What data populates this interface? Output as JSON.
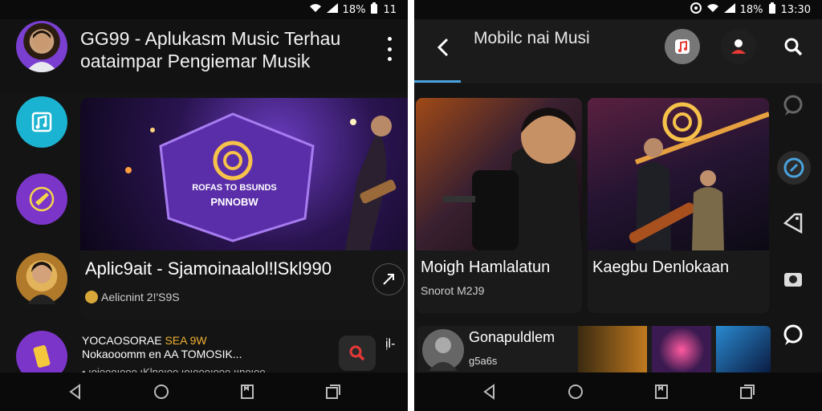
{
  "left": {
    "status": {
      "battery_text": "18%",
      "time": "11"
    },
    "header": {
      "title": "GG99 - Aplukasm Music Terhau oataimpar Pengiemar Musik"
    },
    "feature": {
      "badge_line1": "ROFAS TO BSUNDS",
      "badge_line2": "PNNOBW",
      "title": "Aplic9ait - Sjamoinaalol!lSkl990",
      "subtitle": "Aelicnint 2!'S9S"
    },
    "list_item": {
      "title_prefix": "YOCAOSORAE ",
      "title_highlight": "SEA 9W",
      "title_rest": "Nokaooomm en AA TOMOSIK...",
      "subtitle": "• ıoioooıooo ıKlnoıoo ıoıoooıooo ıınoıoo",
      "extra": "ịl-"
    }
  },
  "right": {
    "status": {
      "battery_text": "18%",
      "time": "13:30"
    },
    "header": {
      "title": "Mobilc nai Musi"
    },
    "cards": [
      {
        "title": "Moigh Hamlalatun",
        "subtitle": "Snorot M2J9"
      },
      {
        "title": "Kaegbu Denlokaan",
        "subtitle": ""
      }
    ],
    "strip": {
      "title": "Gonapuldlem",
      "subtitle": "g5a6s"
    }
  },
  "colors": {
    "accent_blue": "#4aa3df",
    "teal_icon": "#1ab3d1",
    "purple_icon": "#7b35c9",
    "search_red": "#e53935",
    "highlight_orange": "#f0b030"
  }
}
